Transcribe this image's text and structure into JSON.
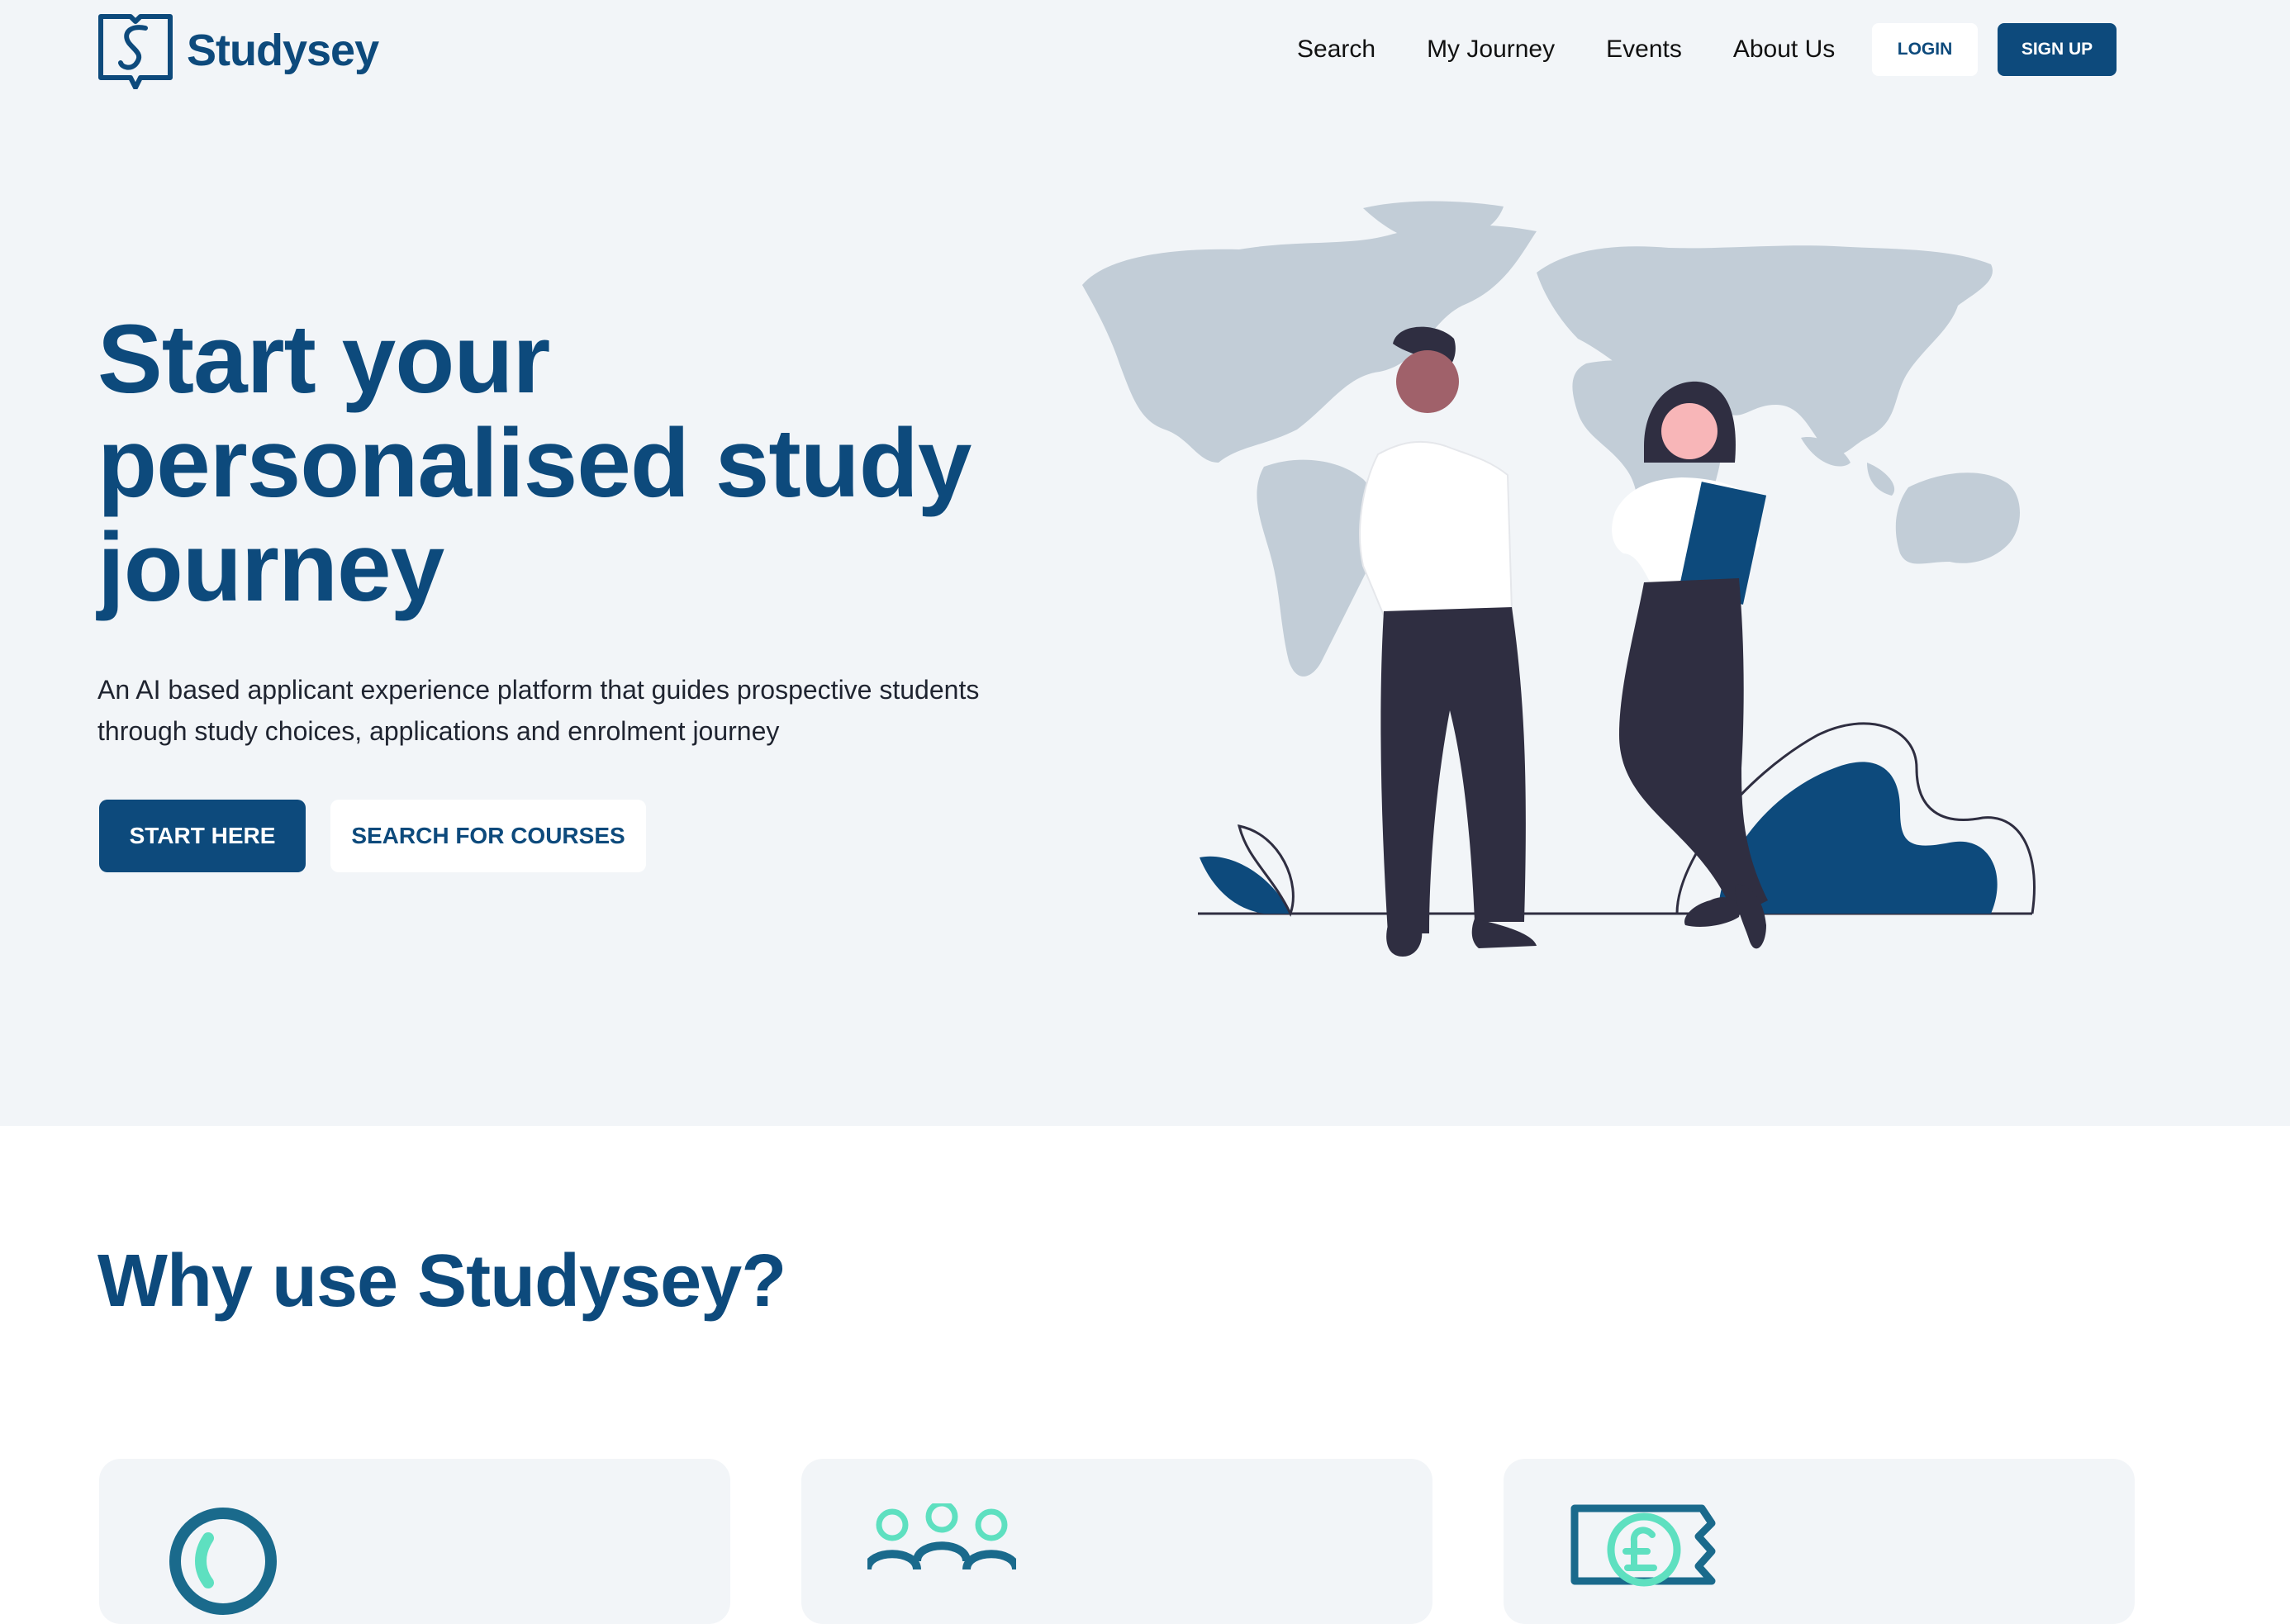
{
  "brand": {
    "name": "Studysey",
    "primary_color": "#0d4a7c",
    "accent_color": "#5ee0c0"
  },
  "nav": {
    "items": [
      "Search",
      "My Journey",
      "Events",
      "About Us"
    ],
    "login": "LOGIN",
    "signup": "SIGN UP"
  },
  "hero": {
    "title": "Start your personalised study journey",
    "subtitle": "An AI based applicant experience platform that guides prospective students through study choices, applications and enrolment journey",
    "primary_cta": "START HERE",
    "secondary_cta": "SEARCH FOR COURSES",
    "illustration": "two-people-world-map-illustration"
  },
  "why": {
    "title": "Why use Studysey?",
    "cards": [
      {
        "icon": "clock-icon"
      },
      {
        "icon": "people-group-icon"
      },
      {
        "icon": "pound-ticket-icon"
      }
    ]
  }
}
